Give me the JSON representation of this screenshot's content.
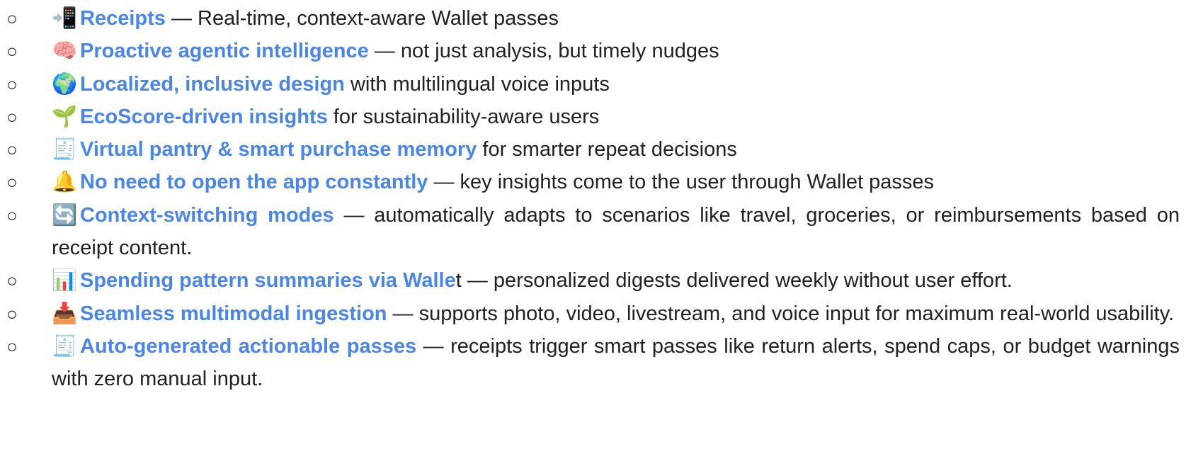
{
  "bullet_char": "○",
  "colors": {
    "highlight": "#4a86e8",
    "text": "#202124"
  },
  "items": [
    {
      "icon": "mobile-arrow-icon",
      "emoji": "📲",
      "highlight": "Receipts",
      "rest": " — Real-time, context-aware Wallet passes"
    },
    {
      "icon": "brain-icon",
      "emoji": "🧠",
      "highlight": "Proactive agentic intelligence",
      "rest": " — not just analysis, but timely nudges"
    },
    {
      "icon": "globe-icon",
      "emoji": "🌍",
      "highlight": "Localized, inclusive design",
      "rest": " with multilingual voice inputs"
    },
    {
      "icon": "seedling-icon",
      "emoji": "🌱",
      "highlight": "EcoScore-driven insights",
      "rest": " for sustainability-aware users"
    },
    {
      "icon": "receipt-icon",
      "emoji": "🧾",
      "highlight": "Virtual pantry & smart purchase memory",
      "rest": " for smarter repeat decisions"
    },
    {
      "icon": "bell-icon",
      "emoji": "🔔",
      "highlight": "No need to open the app constantly",
      "rest": " — key insights come to the user through Wallet passes"
    },
    {
      "icon": "arrows-cycle-icon",
      "emoji": "🔄",
      "highlight": "Context-switching modes",
      "rest": " — automatically adapts to scenarios like travel, groceries, or reimbursements based on receipt content."
    },
    {
      "icon": "bar-chart-icon",
      "emoji": "📊",
      "highlight": "Spending pattern summaries via Walle",
      "rest": "t — personalized digests delivered weekly without user effort."
    },
    {
      "icon": "inbox-tray-icon",
      "emoji": "📥",
      "highlight": "Seamless multimodal ingestion",
      "rest": " — supports photo, video, livestream, and voice input for maximum real-world usability."
    },
    {
      "icon": "receipt-icon",
      "emoji": "🧾",
      "highlight": "Auto-generated actionable passes",
      "rest": " — receipts trigger smart passes like return alerts, spend caps, or budget warnings with zero manual input."
    }
  ]
}
